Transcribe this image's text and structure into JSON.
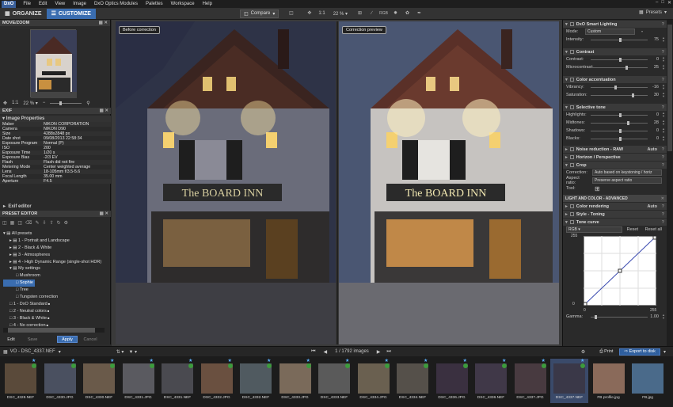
{
  "menubar": {
    "logo": "DxO",
    "items": [
      "File",
      "Edit",
      "View",
      "Image",
      "DxO Optics Modules",
      "Palettes",
      "Workspace",
      "Help"
    ]
  },
  "toolbar": {
    "organize": "ORGANIZE",
    "customize": "CUSTOMIZE",
    "compare": "Compare",
    "ratio": "1:1",
    "zoom": "22 %",
    "presets": "Presets"
  },
  "move_zoom": {
    "title": "MOVE/ZOOM",
    "ratio": "1:1",
    "zoom": "22 %"
  },
  "exif": {
    "title": "EXIF",
    "section": "Image Properties",
    "rows": [
      [
        "Maker",
        "NIKON CORPORATION"
      ],
      [
        "Camera",
        "NIKON D90"
      ],
      [
        "Size",
        "4288x2848 px"
      ],
      [
        "Date shot",
        "09/08/2013 22:58:34"
      ],
      [
        "Exposure Program",
        "Normal (P)"
      ],
      [
        "ISO",
        "200"
      ],
      [
        "Exposure Time",
        "1/20 s"
      ],
      [
        "Exposure Bias",
        "-2/3 EV"
      ],
      [
        "Flash",
        "Flash did not fire"
      ],
      [
        "Metering Mode",
        "Center weighted average"
      ],
      [
        "Lens",
        "18-105mm f/3.5-5.6"
      ],
      [
        "Focal Length",
        "35.00 mm"
      ],
      [
        "Aperture",
        "F4.5"
      ]
    ]
  },
  "exif_editor": "Exif editor",
  "preset_editor": {
    "title": "PRESET EDITOR",
    "tree": [
      {
        "label": "All presets",
        "depth": 0
      },
      {
        "label": "1 - Portrait and Landscape",
        "depth": 1
      },
      {
        "label": "2 - Black & White",
        "depth": 1
      },
      {
        "label": "3 - Atmospheres",
        "depth": 1
      },
      {
        "label": "4 - High Dynamic Range (single-shot HDR)",
        "depth": 1
      },
      {
        "label": "My settings",
        "depth": 1
      },
      {
        "label": "Mushroom",
        "depth": 2
      },
      {
        "label": "Sophie",
        "depth": 2
      },
      {
        "label": "Tree",
        "depth": 2
      },
      {
        "label": "Tungsten correction",
        "depth": 2
      },
      {
        "label": "1 - DxO Standard",
        "depth": 1
      },
      {
        "label": "2 - Neutral colors",
        "depth": 1
      },
      {
        "label": "3 - Black & White",
        "depth": 1
      },
      {
        "label": "4 - No correction",
        "depth": 1
      }
    ],
    "edit": "Edit",
    "save": "Save",
    "apply": "Apply",
    "cancel": "Cancel"
  },
  "viewer": {
    "before_label": "Before correction",
    "after_label": "Correction preview",
    "sign": "The BOARD INN"
  },
  "right": {
    "smart_lighting": {
      "title": "DxO Smart Lighting",
      "mode_label": "Mode:",
      "mode": "Custom",
      "intensity_label": "Intensity:",
      "intensity": "75"
    },
    "contrast": {
      "title": "Contrast",
      "contrast_label": "Contrast:",
      "contrast": "0",
      "micro_label": "Microcontrast:",
      "micro": "25"
    },
    "color_acc": {
      "title": "Color accentuation",
      "vib_label": "Vibrancy:",
      "vib": "-16",
      "sat_label": "Saturation:",
      "sat": "30"
    },
    "tone": {
      "title": "Selective tone",
      "hl_label": "Highlights:",
      "hl": "0",
      "mt_label": "Midtones:",
      "mt": "28",
      "sh_label": "Shadows:",
      "sh": "0",
      "bl_label": "Blacks:",
      "bl": "0"
    },
    "noise": {
      "title": "Noise reduction - RAW",
      "auto": "Auto"
    },
    "horizon": {
      "title": "Horizon / Perspective"
    },
    "crop": {
      "title": "Crop",
      "corr_label": "Correction:",
      "corr": "Auto based on keystoning / horiz",
      "aspect_label": "Aspect ratio:",
      "aspect": "Preserve aspect ratio",
      "tool_label": "Tool:"
    },
    "lca": "LIGHT AND COLOR - ADVANCED",
    "color_rendering": {
      "title": "Color rendering",
      "auto": "Auto"
    },
    "style": {
      "title": "Style - Toning"
    },
    "curve": {
      "title": "Tone curve",
      "channel": "RGB",
      "reset": "Reset",
      "reset_all": "Reset all",
      "y_max": "255",
      "y_min": "0",
      "x_min": "0",
      "x_max": "255",
      "gamma_label": "Gamma:",
      "gamma": "1.00"
    }
  },
  "filmbar": {
    "path": "VO - DSC_4337.NEF",
    "count": "1 / 1792 images",
    "print": "Print",
    "export": "Export to disk"
  },
  "thumbs": [
    "DSC_4328.NEF",
    "DSC_4330.JPG",
    "DSC_4330.NEF",
    "DSC_4331.JPG",
    "DSC_4331.NEF",
    "DSC_4332.JPG",
    "DSC_4332.NEF",
    "DSC_4333.JPG",
    "DSC_4333.NEF",
    "DSC_4334.JPG",
    "DSC_4334.NEF",
    "DSC_4336.JPG",
    "DSC_4336.NEF",
    "DSC_4337.JPG",
    "DSC_4337.NEF",
    "FB profile.jpg",
    "FB.jpg"
  ]
}
